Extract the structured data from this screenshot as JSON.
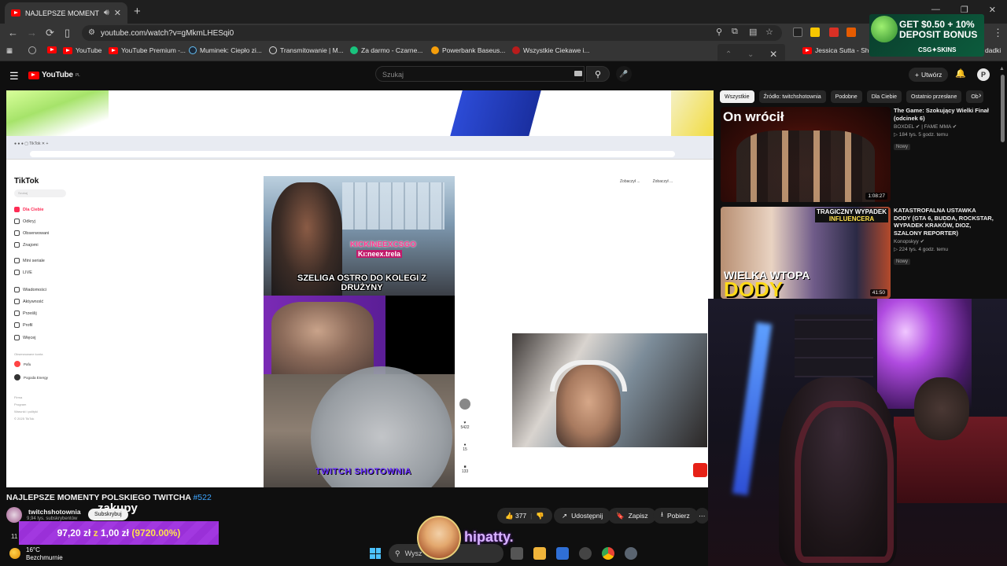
{
  "browser": {
    "tab_title": "NAJLEPSZE MOMENTY POLSKI",
    "new_tab": "+",
    "url": "youtube.com/watch?v=gMkmLHESqi0",
    "window_controls": [
      "—",
      "❐",
      "✕"
    ]
  },
  "bookmarks": [
    {
      "label": "YouTube",
      "color": "#ff0000"
    },
    {
      "label": "YouTube Premium -...",
      "color": "#ff0000"
    },
    {
      "label": "Muminek: Ciepło zi...",
      "color": "#1b2838"
    },
    {
      "label": "Transmitowanie | M...",
      "color": "#cccccc"
    },
    {
      "label": "Za darmo - Czarne...",
      "color": "#19c37d"
    },
    {
      "label": "Powerbank Baseus...",
      "color": "#f59e0b"
    },
    {
      "label": "Wszystkie Ciekawe i...",
      "color": "#b91c1c"
    },
    {
      "label": "Jessica Sutta - Show",
      "color": "#ff0000"
    },
    {
      "label": "dadki",
      "color": "#888888"
    }
  ],
  "promo": {
    "line1": "GET $0.50 + 10%",
    "line2": "DEPOSIT BONUS",
    "brand": "CSG✦SKINS"
  },
  "youtube": {
    "logo": "YouTube",
    "country": "PL",
    "search_placeholder": "Szukaj",
    "create_label": "Utwórz"
  },
  "video": {
    "title": "NAJLEPSZE MOMENTY POLSKIEGO TWITCHA",
    "tag": "#522",
    "channel": "twitchshotownia",
    "subs": "9,94 tys. subskrybentów",
    "subscribe_label": "Subskrybuj",
    "overlay_word": "zakupy",
    "likes": "377",
    "share_label": "Udostępnij",
    "save_label": "Zapisz",
    "download_label": "Pobierz",
    "views_fragment": "11"
  },
  "player_content": {
    "tiktok_logo": "TikTok",
    "tiktok_search": "Szukaj",
    "nav": [
      "Dla Ciebie",
      "Odkryj",
      "Obserwowani",
      "Znajomi",
      "Mini seriale",
      "LIVE",
      "Wiadomości",
      "Aktywność",
      "Prześlij",
      "Profil",
      "Więcej"
    ],
    "followed_header": "Obserwowane konta",
    "accounts": [
      "Pafu",
      "Pogoda Energy"
    ],
    "footer": [
      "Firma",
      "Program",
      "Warunki i polityki",
      "© 2025 TikTok"
    ],
    "kick_text": "KICK/NEEXCSGO",
    "kick_handle": "Kı:neex.trela",
    "caption": "SZELIGA OSTRO DO KOLEGI Z DRUŻYNY",
    "brand": "TWITCH SHOTOWNIA",
    "side_counts": [
      "5422",
      "15",
      "133"
    ],
    "top_buttons": [
      "Zobaczył ...",
      "Zobaczył ..."
    ]
  },
  "donation": {
    "amount": "97,20 zł",
    "sep": "z",
    "goal": "1,00 zł",
    "percent": "(9720.00%)"
  },
  "chips": [
    "Wszystkie",
    "Źródło: twitchshotownia",
    "Podobne",
    "Dla Ciebie",
    "Ostatnio przesłane",
    "Ob"
  ],
  "recommendations": [
    {
      "thumb_text": "On wrócił",
      "title": "The Game: Szokujący Wielki Finał (odcinek 6)",
      "channel": "BOXDEL ✔ | FAME MMA ✔",
      "meta": "▷ 184 tys.  5 godz. temu",
      "badge": "Nowy",
      "duration": "1:08:27"
    },
    {
      "thumb_text_top": "TRAGICZNY WYPADEK",
      "thumb_text_top2": "INFLUENCERA",
      "thumb_text_1": "WIELKA WTOPA",
      "thumb_text_2": "DODY",
      "title": "KATASTROFALNA USTAWKA DODY (GTA 6, BUDDA, ROCKSTAR, WYPADEK KRAKÓW, DIOZ, SZALONY REPORTER)",
      "channel": "Konopskyy ✔",
      "meta": "▷ 224 tys.  4 godz. temu",
      "badge": "Nowy",
      "duration": "41:50"
    }
  ],
  "taskbar": {
    "temp": "16°C",
    "weather": "Bezchmurnie",
    "search": "Wysz"
  },
  "stream": {
    "streamer_name": "hipatty."
  },
  "icons": {
    "menu": "☰",
    "search": "⚲",
    "mic": "🎤",
    "bell": "🔔",
    "like": "👍",
    "dislike": "👎",
    "share": "↗",
    "save": "🔖",
    "download": "⭳",
    "more": "⋯",
    "back": "←",
    "forward": "→",
    "reload": "⟳",
    "chevron_right": "›"
  }
}
